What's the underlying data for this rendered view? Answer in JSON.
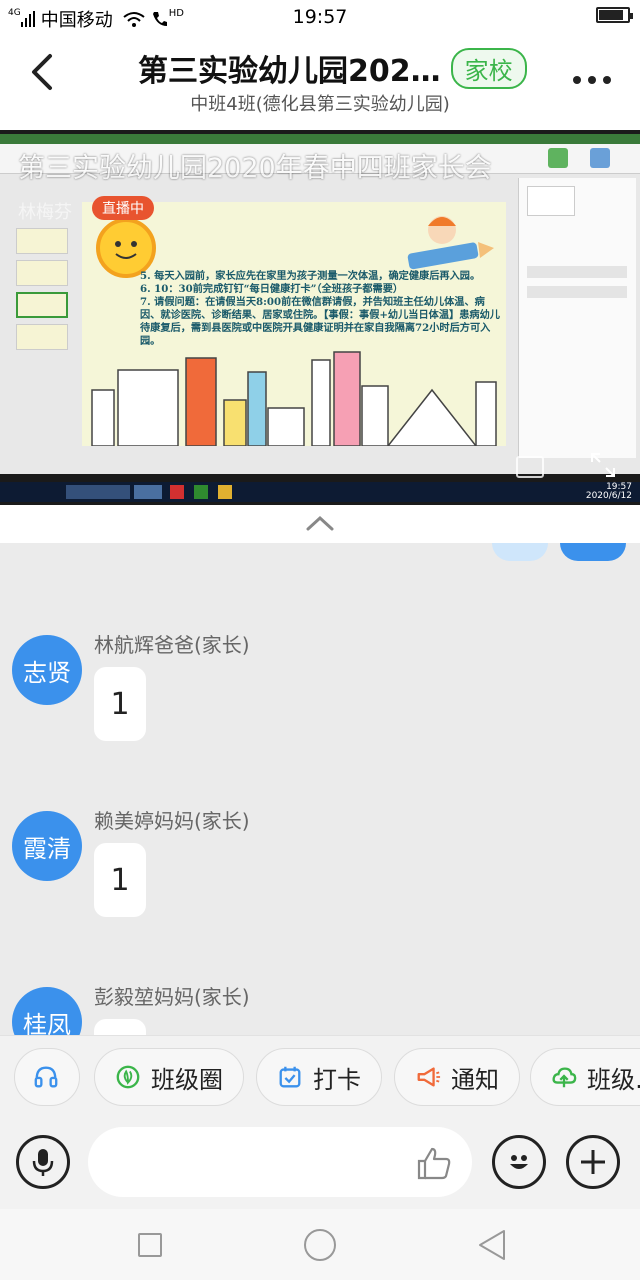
{
  "status_bar": {
    "network": "4G",
    "carrier": "中国移动",
    "hd": "HD",
    "time": "19:57"
  },
  "header": {
    "title": "第三实验幼儿园202…",
    "badge": "家校",
    "subtitle": "中班4班(德化县第三实验幼儿园)"
  },
  "live_video": {
    "overlay_title": "第三实验幼儿园2020年春中四班家长会",
    "host_name": "林梅芬",
    "live_badge": "直播中",
    "slide_text": "5. 每天入园前，家长应先在家里为孩子测量一次体温，确定健康后再入园。\n6. 10：30前完成钉钉“每日健康打卡”（全班孩子都需要）\n7. 请假问题：在请假当天8:00前在微信群请假，并告知班主任幼儿体温、病因、就诊医院、诊断结果、居家或住院。【事假：事假+幼儿当日体温】患病幼儿待康复后，需到县医院或中医院开具健康证明并在家自我隔离72小时后方可入园。",
    "taskbar_time": "19:57",
    "taskbar_date": "2020/6/12"
  },
  "messages": [
    {
      "avatar_text": "志贤",
      "sender": "林航辉爸爸(家长)",
      "text": "1"
    },
    {
      "avatar_text": "霞清",
      "sender": "赖美婷妈妈(家长)",
      "text": "1"
    },
    {
      "avatar_text": "桂凤",
      "sender": "彭毅堃妈妈(家长)",
      "text": ""
    }
  ],
  "quick_actions": [
    {
      "icon": "headset-icon",
      "label": ""
    },
    {
      "icon": "class-circle-icon",
      "label": "班级圈"
    },
    {
      "icon": "checkin-icon",
      "label": "打卡"
    },
    {
      "icon": "megaphone-icon",
      "label": "通知"
    },
    {
      "icon": "cloud-icon",
      "label": "班级…"
    }
  ],
  "colors": {
    "accent_blue": "#3b91ec",
    "badge_green": "#3bb54a",
    "chat_bg": "#ebebeb",
    "live_badge": "#e8542f"
  }
}
